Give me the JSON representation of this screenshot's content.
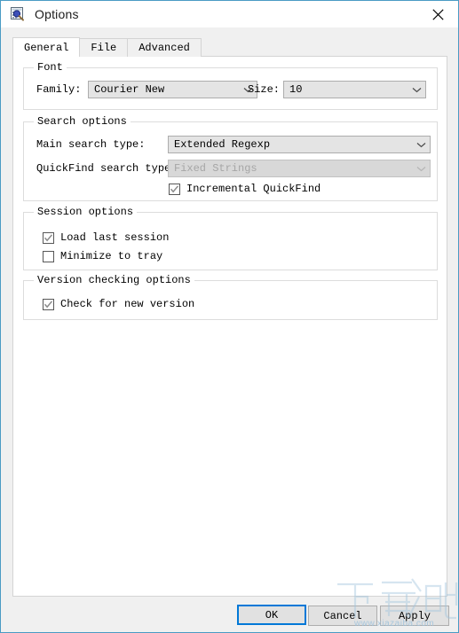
{
  "window": {
    "title": "Options",
    "icon": "options-search-icon",
    "close_label": "✕",
    "accent_color": "#4a9bc4"
  },
  "tabs": [
    {
      "label": "General",
      "active": true
    },
    {
      "label": "File",
      "active": false
    },
    {
      "label": "Advanced",
      "active": false
    }
  ],
  "groups": {
    "font": {
      "title": "Font",
      "family_label": "Family:",
      "family_value": "Courier New",
      "size_label": "Size:",
      "size_value": "10"
    },
    "search": {
      "title": "Search options",
      "main_label": "Main search type:",
      "main_value": "Extended Regexp",
      "quickfind_label": "QuickFind search type:",
      "quickfind_value": "Fixed Strings",
      "incremental_label": "Incremental QuickFind",
      "incremental_checked": true
    },
    "session": {
      "title": "Session options",
      "load_last_label": "Load last session",
      "load_last_checked": true,
      "minimize_label": "Minimize to tray",
      "minimize_checked": false
    },
    "version": {
      "title": "Version checking options",
      "check_label": "Check for new version",
      "check_checked": true
    }
  },
  "footer": {
    "ok_label": "OK",
    "cancel_label": "Cancel",
    "apply_label": "Apply"
  },
  "watermark": {
    "text": "下载吧",
    "url": "www.xiazaiba.com"
  }
}
